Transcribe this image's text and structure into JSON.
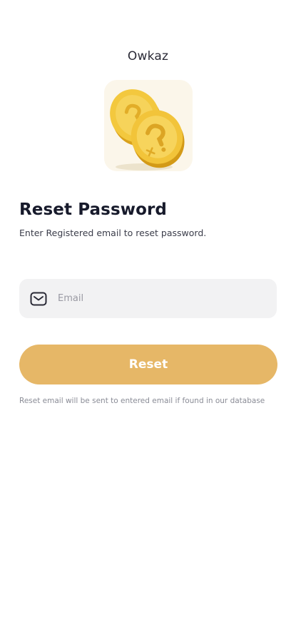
{
  "app": {
    "title": "Owkaz"
  },
  "logo": {
    "icon": "gold-coins-icon",
    "colors": {
      "tile_bg": "#fbf6ea",
      "coin": "#f0c53c",
      "coin_edge": "#d9a11c"
    }
  },
  "page": {
    "heading": "Reset Password",
    "subheading": "Enter Registered email to reset password."
  },
  "form": {
    "email": {
      "icon": "mail-icon",
      "placeholder": "Email",
      "value": ""
    },
    "reset_label": "Reset",
    "note": "Reset email will be sent to entered email if found in our database"
  },
  "colors": {
    "accent": "#e6b767",
    "field_bg": "#f2f2f3"
  }
}
